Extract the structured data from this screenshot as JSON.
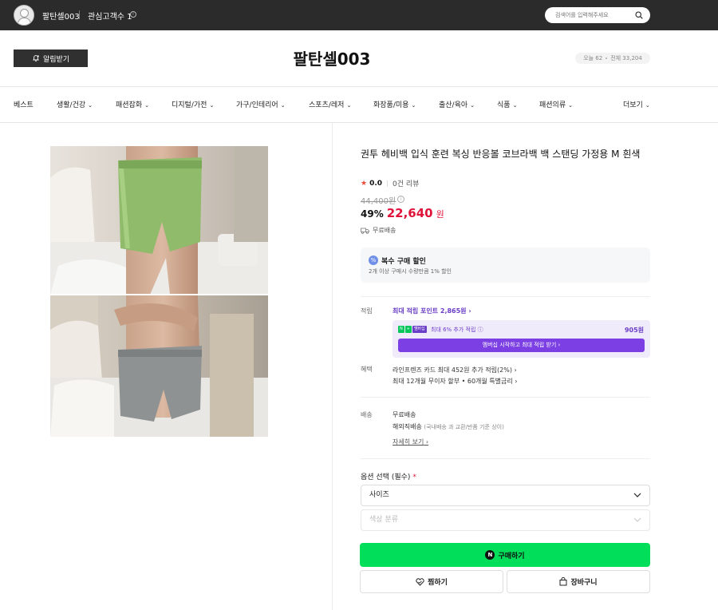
{
  "topbar": {
    "store_name": "팔탄셀003",
    "follow_label": "관심고객수 1",
    "info_icon": "i",
    "search_placeholder": "검색어를 입력해주세요"
  },
  "header": {
    "alarm_label": "알림받기",
    "brand": "팔탄셀003",
    "visitors_today": "오늘 62",
    "visitors_total": "전체 33,204"
  },
  "nav": {
    "items": [
      {
        "label": "베스트"
      },
      {
        "label": "생활/건강"
      },
      {
        "label": "패션잡화"
      },
      {
        "label": "디지털/가전"
      },
      {
        "label": "가구/인테리어"
      },
      {
        "label": "스포츠/레저"
      },
      {
        "label": "화장품/미용"
      },
      {
        "label": "출산/육아"
      },
      {
        "label": "식품"
      },
      {
        "label": "패션의류"
      }
    ],
    "more_label": "더보기"
  },
  "product": {
    "title": "권투 헤비백 입식 훈련 복싱 반응볼 코브라백 백 스탠딩 가정용 M 흰색",
    "rating": "0.0",
    "reviews": "0건 리뷰",
    "original_price": "44,400원",
    "discount": "49%",
    "price": "22,640",
    "currency": "원",
    "shipping": "무료배송"
  },
  "bulk": {
    "icon": "%",
    "title": "복수 구매 할인",
    "desc": "2개 이상 구매시 수량만큼 1% 할인"
  },
  "points": {
    "label": "적립",
    "link": "최대 적립 포인트 2,865원",
    "badge_n": "N",
    "badge_plus": "+",
    "badge_member": "멤버십",
    "extra": "최대 6% 추가 적립",
    "amount": "905원",
    "membership_btn": "멤버십 시작하고 최대 적립 받기"
  },
  "benefit": {
    "label": "혜택",
    "line1": "라인프렌즈 카드 최대 452원 추가 적립(2%)",
    "line2": "최대 12개월 무이자 할부 • 60개월 특별금리"
  },
  "delivery": {
    "label": "배송",
    "line1": "무료배송",
    "line2": "해외직배송",
    "line2_note": "(국내배송 과 교환/반품 기준 상이)",
    "detail_link": "자세히 보기"
  },
  "options": {
    "label": "옵션 선택 (필수)",
    "required_mark": "*",
    "size": "사이즈",
    "color": "색상 분류"
  },
  "actions": {
    "buy_logo": "N",
    "buy": "구매하기",
    "wish": "찜하기",
    "cart": "장바구니"
  },
  "colors": {
    "buy_green": "#00de5a",
    "price_red": "#e0143a",
    "membership_purple": "#7b3fe4"
  }
}
